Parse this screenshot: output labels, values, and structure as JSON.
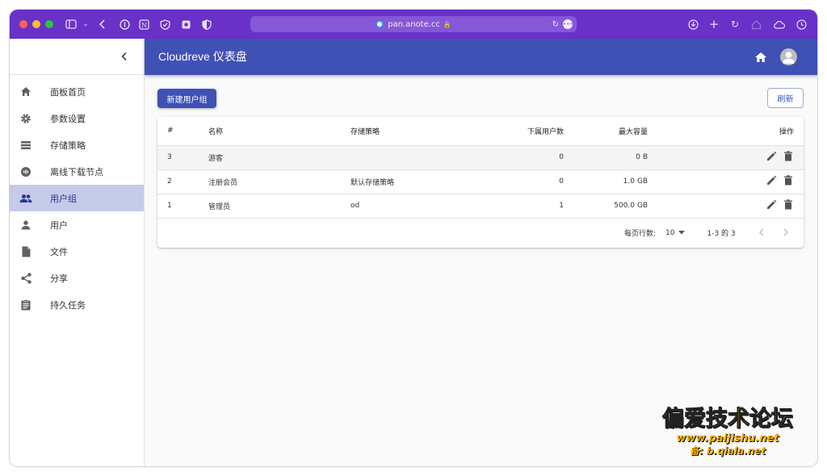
{
  "browser": {
    "url": "pan.anote.cc"
  },
  "app": {
    "title": "Cloudreve 仪表盘"
  },
  "sidebar": {
    "items": [
      {
        "label": "面板首页",
        "icon": "home-icon"
      },
      {
        "label": "参数设置",
        "icon": "gear-icon"
      },
      {
        "label": "存储策略",
        "icon": "storage-icon"
      },
      {
        "label": "离线下载节点",
        "icon": "download-node-icon"
      },
      {
        "label": "用户组",
        "icon": "people-icon",
        "active": true
      },
      {
        "label": "用户",
        "icon": "person-icon"
      },
      {
        "label": "文件",
        "icon": "file-icon"
      },
      {
        "label": "分享",
        "icon": "share-icon"
      },
      {
        "label": "持久任务",
        "icon": "task-icon"
      }
    ]
  },
  "toolbar": {
    "new_group_label": "新建用户组",
    "refresh_label": "刷新"
  },
  "table": {
    "headers": {
      "id": "#",
      "name": "名称",
      "policy": "存储策略",
      "users": "下属用户数",
      "capacity": "最大容量",
      "actions": "操作"
    },
    "rows": [
      {
        "id": "3",
        "name": "游客",
        "policy": "",
        "users": "0",
        "capacity": "0 B"
      },
      {
        "id": "2",
        "name": "注册会员",
        "policy": "默认存储策略",
        "users": "0",
        "capacity": "1.0 GB"
      },
      {
        "id": "1",
        "name": "管理员",
        "policy": "od",
        "users": "1",
        "capacity": "500.0 GB"
      }
    ]
  },
  "pagination": {
    "rows_per_page_label": "每页行数:",
    "rows_per_page": "10",
    "range": "1-3 的 3"
  },
  "watermark": {
    "title": "偏爱技术论坛",
    "url": "www.paijishu.net",
    "backup": "备: b.qiala.net"
  },
  "colors": {
    "chrome": "#6931c8",
    "primary": "#3f51b5",
    "active_nav": "#c5cae9"
  }
}
